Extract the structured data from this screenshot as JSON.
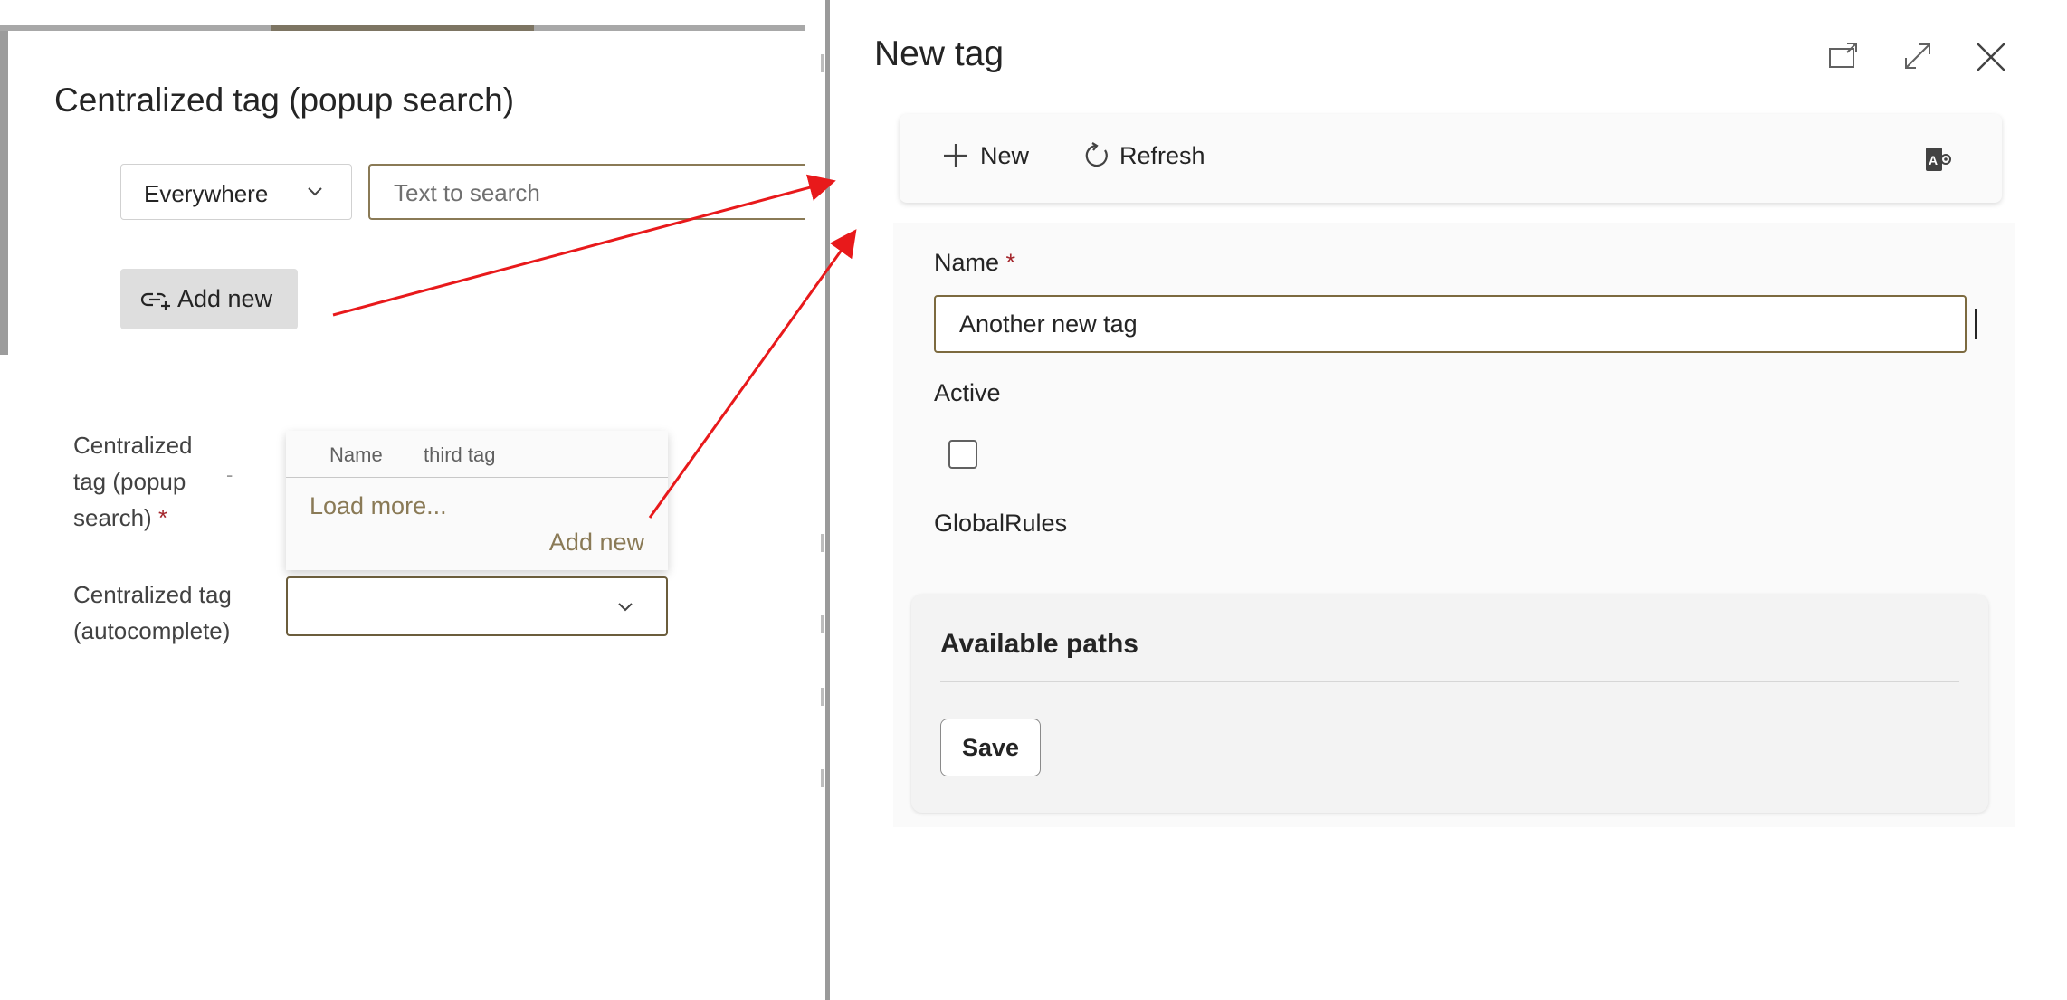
{
  "background_dialog": {
    "title": "Centralized tag (popup search)",
    "scope_select": {
      "value": "Everywhere"
    },
    "search_input": {
      "placeholder": "Text to search",
      "value": ""
    },
    "add_new_button": "Add new",
    "fields": {
      "popup_search_label_line1": "Centralized",
      "popup_search_label_line2": "tag (popup",
      "popup_search_label_line3": "search)",
      "required_mark": "*",
      "dash": "-",
      "autocomplete_label_line1": "Centralized tag",
      "autocomplete_label_line2": "(autocomplete)"
    },
    "dropdown": {
      "header_name": "Name",
      "header_value": "third tag",
      "load_more": "Load more...",
      "add_new": "Add new"
    }
  },
  "panel": {
    "title": "New tag",
    "toolbar": {
      "new_label": "New",
      "refresh_label": "Refresh"
    },
    "form": {
      "name_label": "Name",
      "required_mark": "*",
      "name_value": "Another new tag",
      "active_label": "Active",
      "active_checked": false,
      "global_rules_label": "GlobalRules"
    },
    "paths_card": {
      "title": "Available paths",
      "save_label": "Save"
    }
  },
  "colors": {
    "accent": "#8a7a56",
    "arrow": "#e8191b",
    "required": "#a4262c"
  }
}
